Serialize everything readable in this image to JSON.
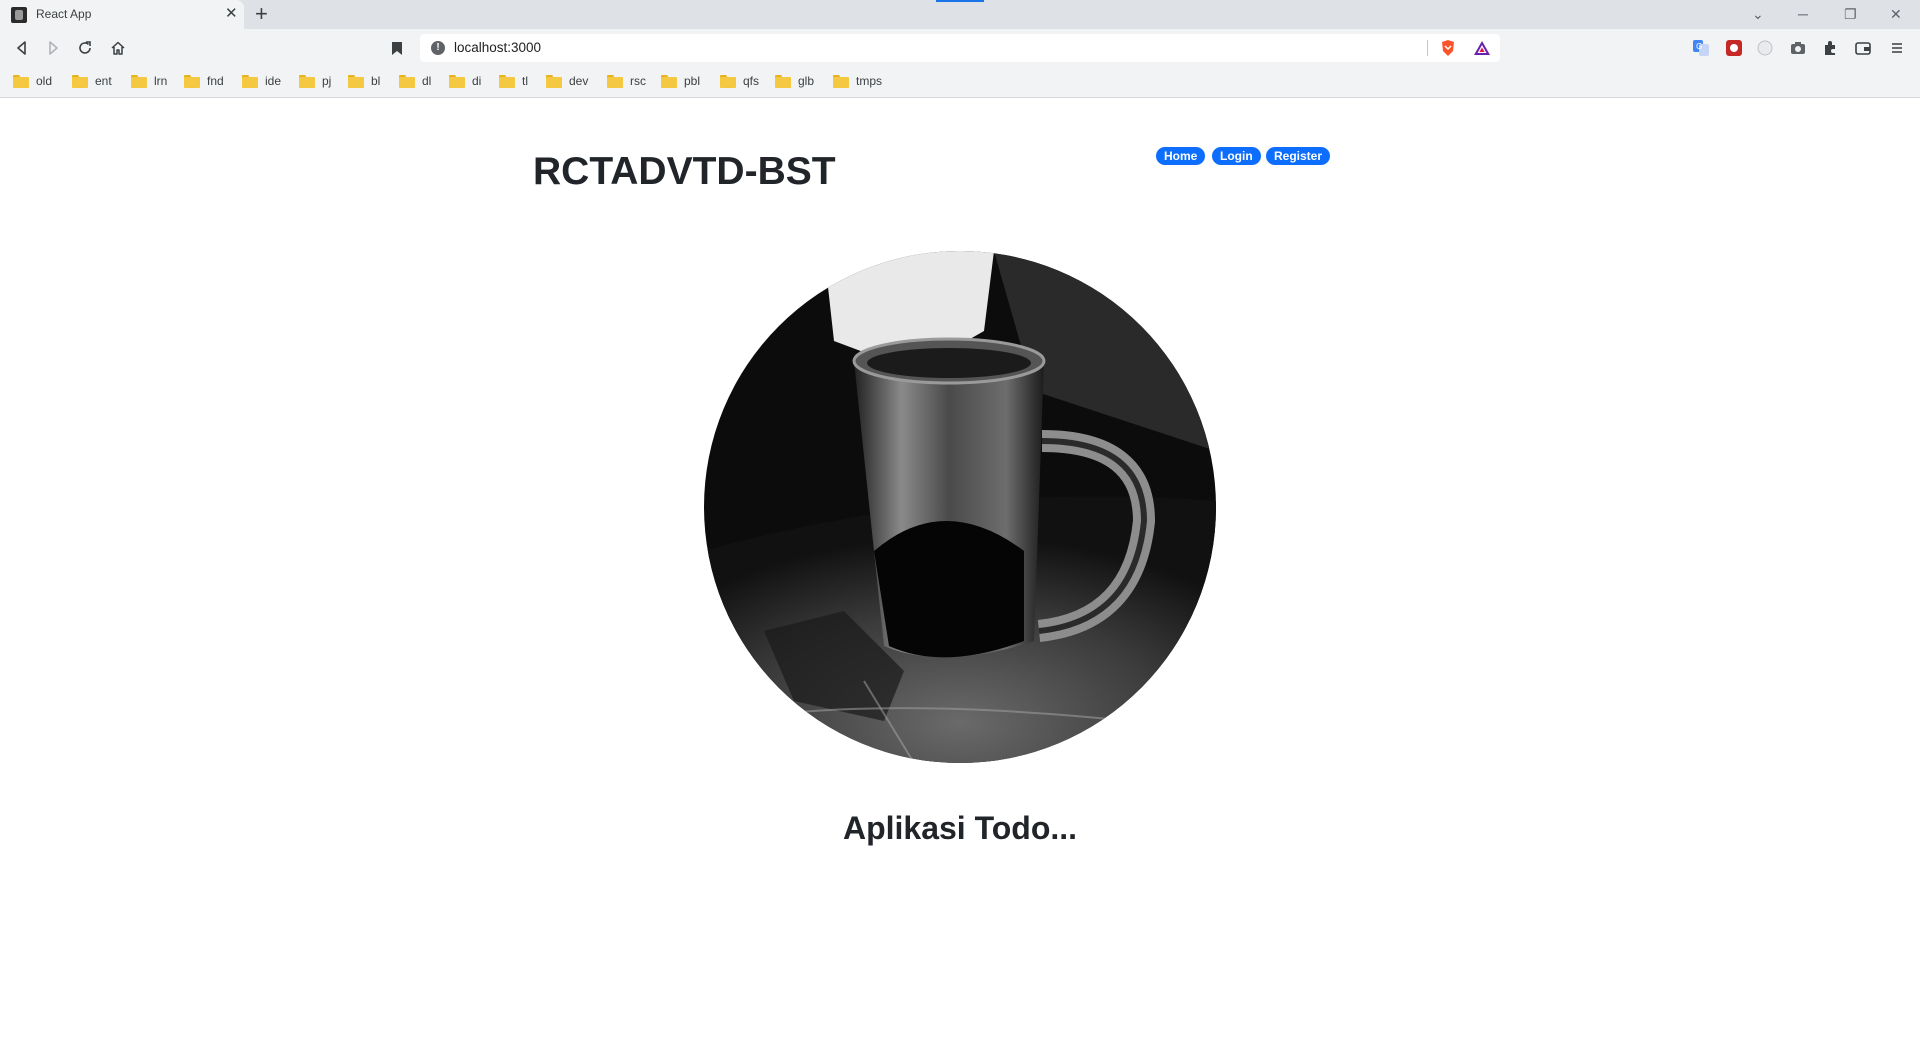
{
  "browser": {
    "tab_title": "React App",
    "url": "localhost:3000",
    "bookmarks": [
      "old",
      "ent",
      "lrn",
      "fnd",
      "ide",
      "pj",
      "bl",
      "dl",
      "di",
      "tl",
      "dev",
      "rsc",
      "pbl",
      "qfs",
      "glb",
      "tmps"
    ]
  },
  "header": {
    "title": "RCTADVTD-BST",
    "nav": {
      "home": "Home",
      "login": "Login",
      "register": "Register"
    },
    "accent_color": "#0d6efd"
  },
  "main": {
    "hero_image": "coffee-mug-photo",
    "subtitle": "Aplikasi Todo..."
  }
}
